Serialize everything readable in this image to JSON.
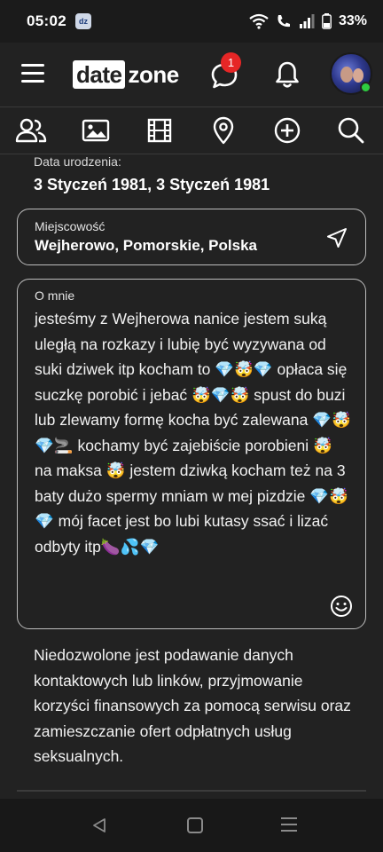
{
  "status_bar": {
    "time": "05:02",
    "app_badge": "dz",
    "battery": "33%"
  },
  "header": {
    "logo_left": "date",
    "logo_right": "zone",
    "notification_count": "1"
  },
  "profile": {
    "birth_date_label": "Data urodzenia:",
    "birth_date_value": "3 Styczeń 1981, 3 Styczeń 1981",
    "city_label": "Miejscowość",
    "city_value": "Wejherowo, Pomorskie, Polska",
    "about_label": "O mnie",
    "about_value": "jesteśmy z Wejherowa nanice jestem suką uległą na rozkazy i lubię być wyzywana od suki dziwek itp kocham to 💎🤯💎 opłaca się suczkę porobić i jebać 🤯💎🤯 spust do buzi lub zlewamy formę kocha być zalewana 💎🤯💎🚬 kochamy być zajebiście porobieni 🤯 na maksa 🤯 jestem dziwką kocham też na 3 baty dużo spermy mniam w mej pizdzie 💎🤯💎 mój facet jest bo lubi kutasy ssać i lizać odbyty itp🍆💦💎"
  },
  "notice": "Niedozwolone jest podawanie danych kontaktowych lub linków, przyjmowanie korzyści finansowych za pomocą serwisu oraz zamieszczanie ofert odpłatnych usług seksualnych.",
  "colors": {
    "background": "#222222",
    "badge": "#e62626",
    "online": "#2ecc40",
    "border": "#bdbdbd"
  },
  "icons": [
    "people-icon",
    "image-icon",
    "film-icon",
    "location-pin-icon",
    "add-circle-icon",
    "search-icon",
    "chat-icon",
    "bell-icon",
    "navigation-arrow-icon",
    "smile-icon"
  ]
}
